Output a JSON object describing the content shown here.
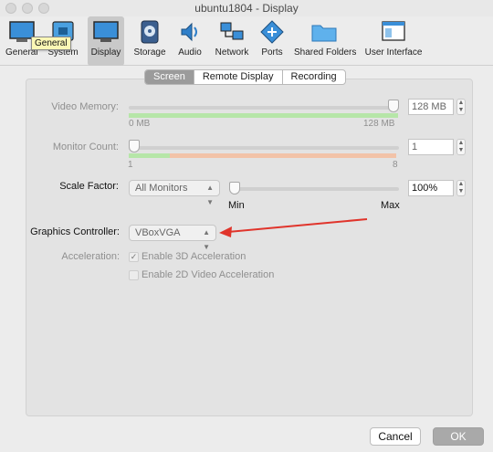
{
  "window": {
    "title": "ubuntu1804 - Display"
  },
  "toolbar": {
    "items": [
      {
        "label": "General",
        "icon": "general-icon"
      },
      {
        "label": "System",
        "icon": "system-icon"
      },
      {
        "label": "Display",
        "icon": "display-icon",
        "active": true
      },
      {
        "label": "Storage",
        "icon": "storage-icon"
      },
      {
        "label": "Audio",
        "icon": "audio-icon"
      },
      {
        "label": "Network",
        "icon": "network-icon"
      },
      {
        "label": "Ports",
        "icon": "ports-icon"
      },
      {
        "label": "Shared Folders",
        "icon": "folder-icon"
      },
      {
        "label": "User Interface",
        "icon": "user-interface-icon"
      }
    ],
    "tooltip": "General"
  },
  "tabs": [
    {
      "label": "Screen",
      "selected": true
    },
    {
      "label": "Remote Display"
    },
    {
      "label": "Recording"
    }
  ],
  "screen": {
    "video_memory": {
      "label": "Video Memory:",
      "min_label": "0 MB",
      "max_label": "128 MB",
      "value": "128 MB",
      "fraction": 1.0
    },
    "monitor_count": {
      "label": "Monitor Count:",
      "min_label": "1",
      "max_label": "8",
      "value": "1",
      "fraction": 0.0
    },
    "scale_factor": {
      "label": "Scale Factor:",
      "scope": "All Monitors",
      "min_label": "Min",
      "max_label": "Max",
      "value": "100%"
    },
    "graphics_controller": {
      "label": "Graphics Controller:",
      "value": "VBoxVGA"
    },
    "acceleration": {
      "label": "Acceleration:",
      "enable_3d": {
        "label": "Enable 3D Acceleration",
        "checked": true
      },
      "enable_2d": {
        "label": "Enable 2D Video Acceleration",
        "checked": false
      }
    }
  },
  "buttons": {
    "cancel": "Cancel",
    "ok": "OK"
  },
  "colors": {
    "annotation_arrow": "#e0342b",
    "good_zone": "#b6e6a8",
    "warn_zone": "#f2c3a8",
    "tooltip_bg": "#fbf7b5"
  }
}
